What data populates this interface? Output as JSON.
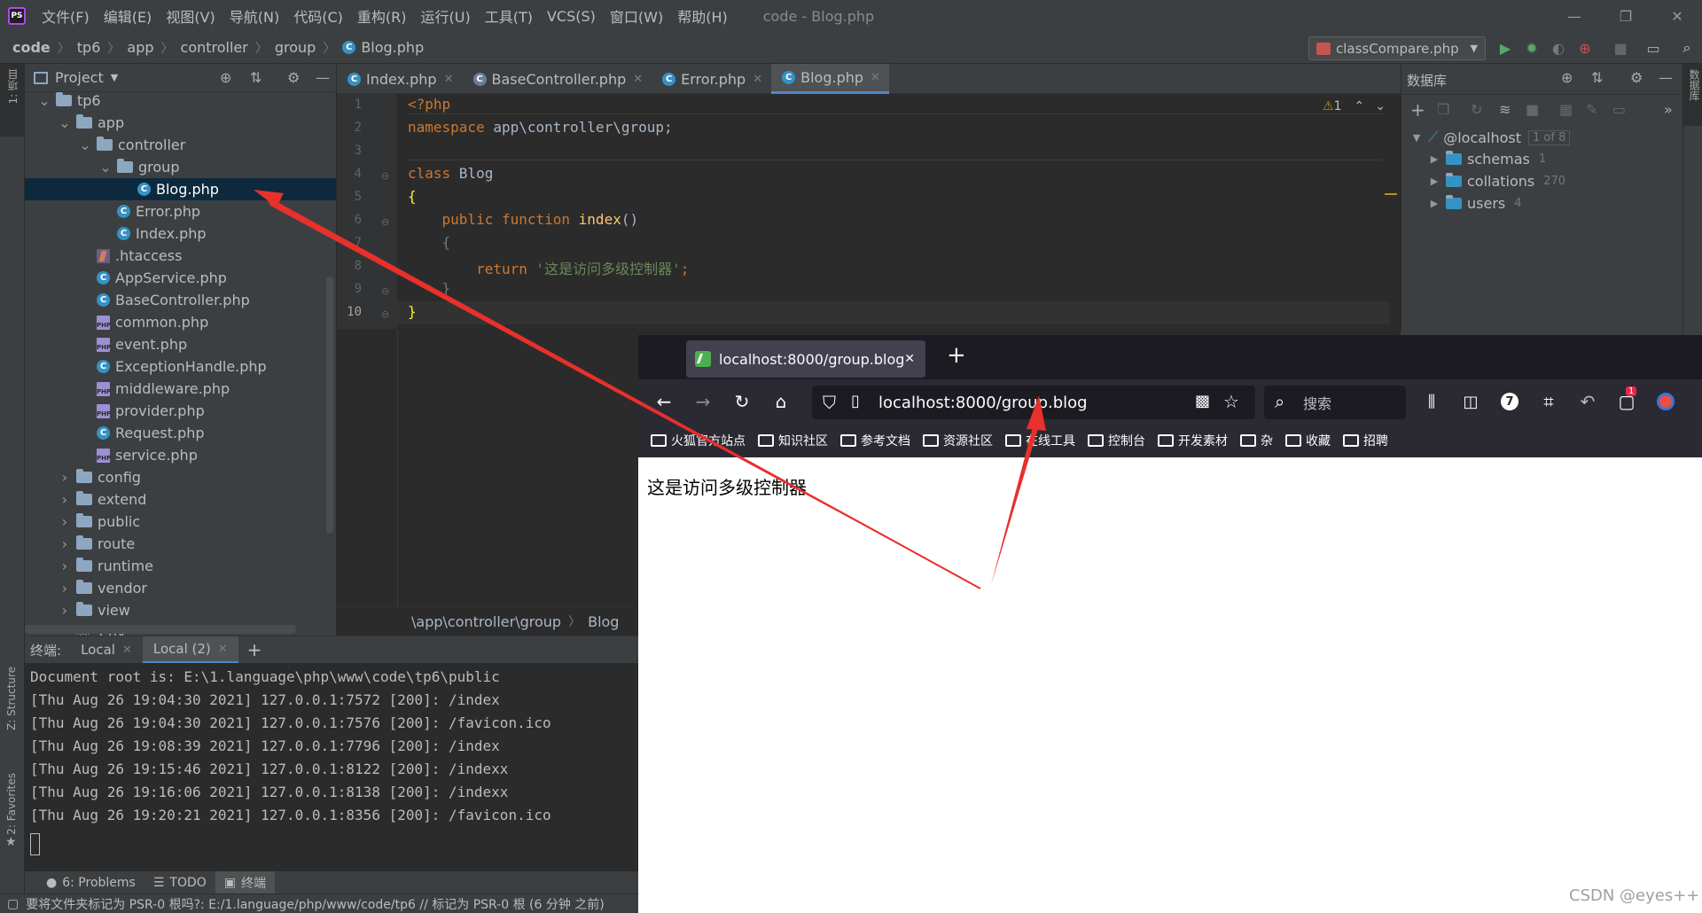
{
  "menubar": {
    "items": [
      "文件(F)",
      "编辑(E)",
      "视图(V)",
      "导航(N)",
      "代码(C)",
      "重构(R)",
      "运行(U)",
      "工具(T)",
      "VCS(S)",
      "窗口(W)",
      "帮助(H)"
    ],
    "window_title": "code - Blog.php",
    "logo": "PS"
  },
  "navbar": {
    "breadcrumbs": [
      "code",
      "tp6",
      "app",
      "controller",
      "group",
      "Blog.php"
    ],
    "run_config": "classCompare.php"
  },
  "left_strip": {
    "project_label": "1: 项目",
    "structure_label": "Z: Structure",
    "favorites_label": "2: Favorites"
  },
  "right_strip": {
    "db_label": "数据库"
  },
  "project": {
    "title": "Project",
    "tree": [
      {
        "label": "tp6",
        "kind": "folder",
        "open": true,
        "indent": 1
      },
      {
        "label": "app",
        "kind": "folder",
        "open": true,
        "indent": 2
      },
      {
        "label": "controller",
        "kind": "folder",
        "open": true,
        "indent": 3
      },
      {
        "label": "group",
        "kind": "folder",
        "open": true,
        "indent": 4
      },
      {
        "label": "Blog.php",
        "kind": "class",
        "indent": 5,
        "selected": true
      },
      {
        "label": "Error.php",
        "kind": "class",
        "indent": 4
      },
      {
        "label": "Index.php",
        "kind": "class",
        "indent": 4
      },
      {
        "label": ".htaccess",
        "kind": "ht",
        "indent": 3
      },
      {
        "label": "AppService.php",
        "kind": "class",
        "indent": 3
      },
      {
        "label": "BaseController.php",
        "kind": "class",
        "indent": 3
      },
      {
        "label": "common.php",
        "kind": "php",
        "indent": 3
      },
      {
        "label": "event.php",
        "kind": "php",
        "indent": 3
      },
      {
        "label": "ExceptionHandle.php",
        "kind": "class",
        "indent": 3
      },
      {
        "label": "middleware.php",
        "kind": "php",
        "indent": 3
      },
      {
        "label": "provider.php",
        "kind": "php",
        "indent": 3
      },
      {
        "label": "Request.php",
        "kind": "class",
        "indent": 3
      },
      {
        "label": "service.php",
        "kind": "php",
        "indent": 3
      },
      {
        "label": "config",
        "kind": "folder",
        "open": false,
        "indent": 2
      },
      {
        "label": "extend",
        "kind": "folder",
        "open": false,
        "indent": 2
      },
      {
        "label": "public",
        "kind": "folder",
        "open": false,
        "indent": 2
      },
      {
        "label": "route",
        "kind": "folder",
        "open": false,
        "indent": 2
      },
      {
        "label": "runtime",
        "kind": "folder",
        "open": false,
        "indent": 2
      },
      {
        "label": "vendor",
        "kind": "folder",
        "open": false,
        "indent": 2
      },
      {
        "label": "view",
        "kind": "folder",
        "open": false,
        "indent": 2
      },
      {
        "label": ".env",
        "kind": "php",
        "indent": 2
      }
    ]
  },
  "editor": {
    "tabs": [
      {
        "label": "Index.php",
        "active": false
      },
      {
        "label": "BaseController.php",
        "active": false
      },
      {
        "label": "Error.php",
        "active": false
      },
      {
        "label": "Blog.php",
        "active": true
      }
    ],
    "warning_count": "1",
    "line_numbers": [
      "1",
      "2",
      "3",
      "4",
      "5",
      "6",
      "7",
      "8",
      "9",
      "10"
    ],
    "code": {
      "l1": "<?php",
      "l2_kw": "namespace",
      "l2_rest": " app\\controller\\group;",
      "l4_kw": "class",
      "l4_rest": " Blog",
      "l5": "{",
      "l6_kw": "    public function",
      "l6_fn": " index",
      "l6_rest": "()",
      "l7": "    {",
      "l8_kw": "        return",
      "l8_str": " '这是访问多级控制器'",
      "l8_rest": ";",
      "l9": "    }",
      "l10": "}"
    },
    "breadcrumb_path": "\\app\\controller\\group",
    "breadcrumb_class": "Blog"
  },
  "database": {
    "title": "数据库",
    "host": "@localhost",
    "host_badge": "1 of 8",
    "items": [
      {
        "label": "schemas",
        "count": "1"
      },
      {
        "label": "collations",
        "count": "270"
      },
      {
        "label": "users",
        "count": "4"
      }
    ]
  },
  "terminal": {
    "label": "终端:",
    "tabs": [
      "Local",
      "Local (2)"
    ],
    "lines": [
      "Document root is: E:\\1.language\\php\\www\\code\\tp6\\public",
      "[Thu Aug 26 19:04:30 2021] 127.0.0.1:7572 [200]: /index",
      "[Thu Aug 26 19:04:30 2021] 127.0.0.1:7576 [200]: /favicon.ico",
      "[Thu Aug 26 19:08:39 2021] 127.0.0.1:7796 [200]: /index",
      "[Thu Aug 26 19:15:46 2021] 127.0.0.1:8122 [200]: /indexx",
      "[Thu Aug 26 19:16:06 2021] 127.0.0.1:8138 [200]: /indexx",
      "[Thu Aug 26 19:20:21 2021] 127.0.0.1:8356 [200]: /favicon.ico"
    ]
  },
  "bottom_tabs": [
    "6: Problems",
    "TODO",
    "终端"
  ],
  "status": "要将文件夹标记为 PSR-0 根吗?: E:/1.language/php/www/code/tp6 // 标记为 PSR-0 根 (6 分钟 之前)",
  "browser": {
    "tab_title": "localhost:8000/group.blog",
    "url": "localhost:8000/group.blog",
    "search_placeholder": "搜索",
    "badge_count": "1",
    "bookmarks": [
      "火狐官方站点",
      "知识社区",
      "参考文档",
      "资源社区",
      "在线工具",
      "控制台",
      "开发素材",
      "杂",
      "收藏",
      "招聘"
    ],
    "page_text": "这是访问多级控制器",
    "colors": {
      "tab_bar": "#1c1b22",
      "toolbar": "#2b2a33"
    }
  },
  "watermark": "CSDN @eyes++",
  "colors": {
    "ide_bg": "#3c3f41",
    "editor_bg": "#2b2b2b",
    "keyword": "#cc7832",
    "string": "#6a8759",
    "function": "#ffc66d",
    "annotation_arrow": "#e8302c"
  }
}
